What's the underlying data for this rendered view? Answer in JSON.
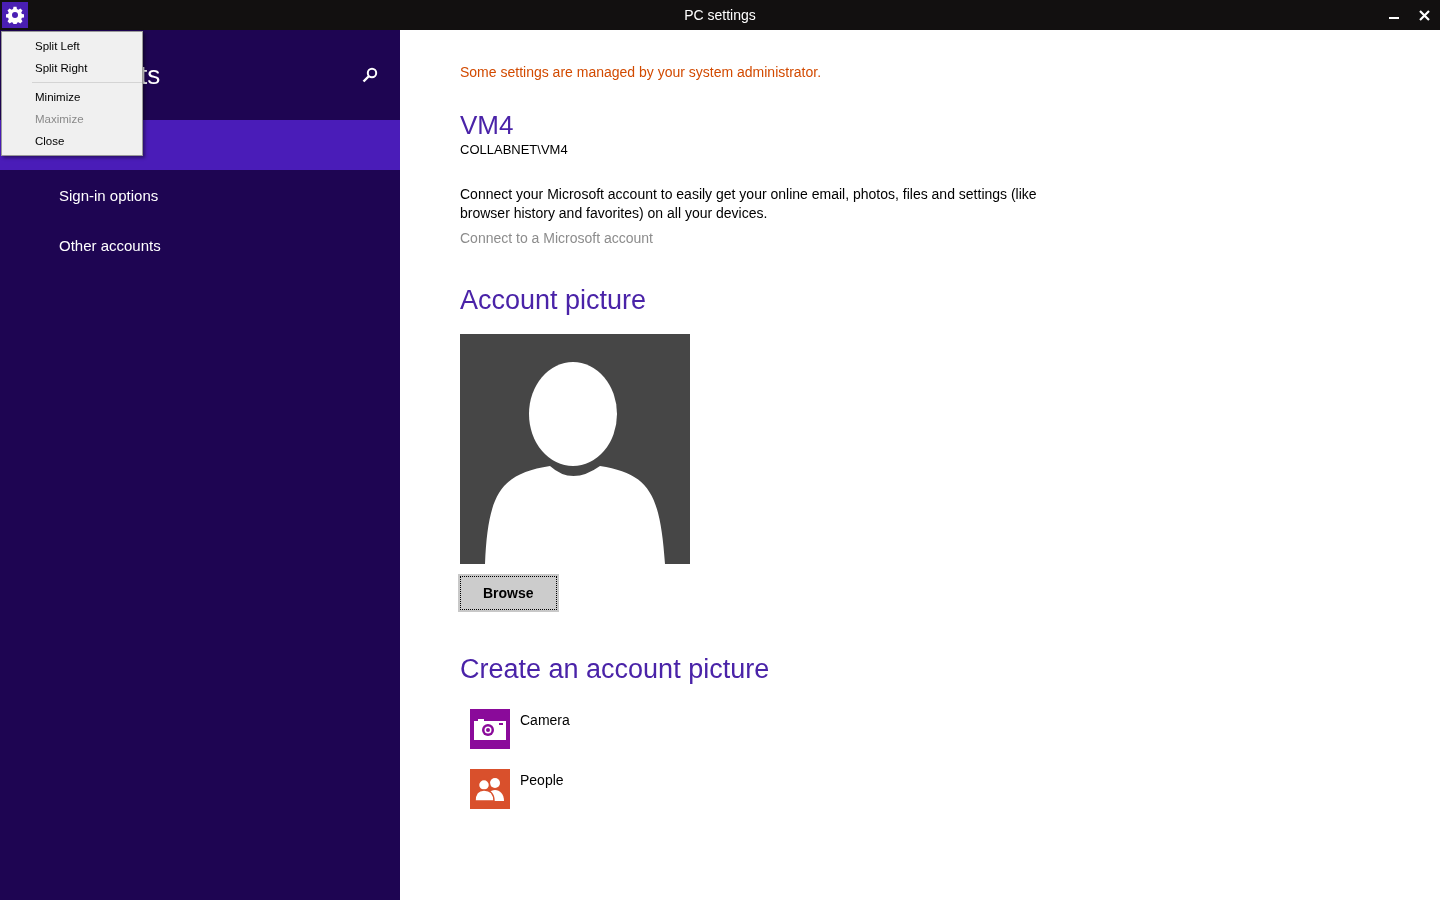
{
  "window": {
    "title": "PC settings"
  },
  "sidebar": {
    "title": "ts",
    "items": [
      {
        "selected": true
      },
      {
        "label": "Sign-in options",
        "selected": false
      },
      {
        "label": "Other accounts",
        "selected": false
      }
    ]
  },
  "system_menu": {
    "groups": [
      [
        {
          "label": "Split Left",
          "disabled": false
        },
        {
          "label": "Split Right",
          "disabled": false
        }
      ],
      [
        {
          "label": "Minimize",
          "disabled": false
        },
        {
          "label": "Maximize",
          "disabled": true
        },
        {
          "label": "Close",
          "disabled": false
        }
      ]
    ]
  },
  "content": {
    "admin_notice": "Some settings are managed by your system administrator.",
    "user_name": "VM4",
    "account_id": "COLLABNET\\VM4",
    "description": "Connect your Microsoft account to easily get your online email, photos, files and settings (like browser history and favorites) on all your devices.",
    "connect_link": "Connect to a Microsoft account",
    "picture_heading": "Account picture",
    "browse_button": "Browse",
    "create_heading": "Create an account picture",
    "apps": [
      {
        "label": "Camera",
        "kind": "camera",
        "color": "#8a0a9a"
      },
      {
        "label": "People",
        "kind": "people",
        "color": "#d9502c"
      }
    ]
  }
}
